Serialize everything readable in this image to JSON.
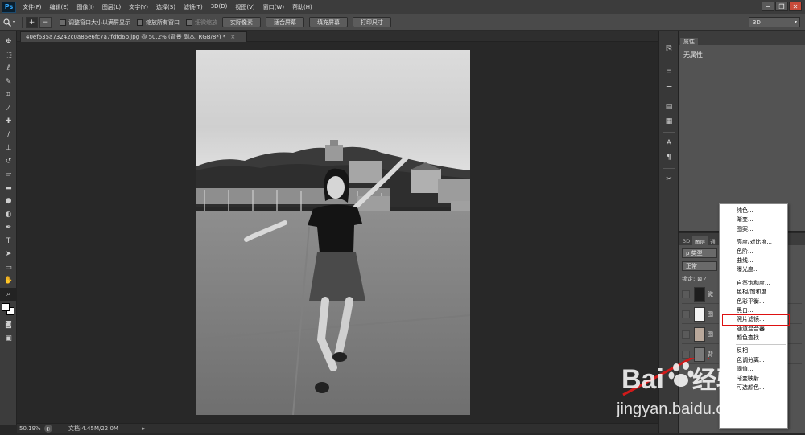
{
  "app": {
    "logo_text": "Ps"
  },
  "menu": [
    "文件(F)",
    "编辑(E)",
    "图像(I)",
    "图层(L)",
    "文字(Y)",
    "选择(S)",
    "滤镜(T)",
    "3D(D)",
    "视图(V)",
    "窗口(W)",
    "帮助(H)"
  ],
  "window_controls": {
    "minimize": "−",
    "restore": "❐",
    "close": "✕"
  },
  "options_bar": {
    "tool_icon": "zoom-icon",
    "zoom_in": "+",
    "zoom_out": "−",
    "checkboxes": [
      {
        "label": "调整窗口大小以满屏显示",
        "enabled": true
      },
      {
        "label": "缩放所有窗口",
        "enabled": true
      },
      {
        "label": "细微缩放",
        "enabled": false
      }
    ],
    "buttons": [
      "实际像素",
      "适合屏幕",
      "填充屏幕",
      "打印尺寸"
    ],
    "workspace": "3D"
  },
  "document": {
    "tab_title": "40ef635a73242c0a86e6fc7a7fdfd6b.jpg @ 50.2% (背景 副本, RGB/8*) *",
    "tab_close": "×"
  },
  "status": {
    "zoom": "50.19%",
    "doc_info": "文档:4.45M/22.0M",
    "arrow": "▸"
  },
  "properties_panel": {
    "tab": "属性",
    "body": "无属性"
  },
  "layers_panel": {
    "tabs": [
      "3D",
      "图层",
      "通"
    ],
    "filter": "ρ 类型",
    "blend_mode": "正常",
    "lock_label": "锁定:",
    "layers": [
      {
        "name": "微",
        "thumb": "#1e1e1e"
      },
      {
        "name": "图",
        "thumb": "#f4f4f4"
      },
      {
        "name": "图",
        "thumb": "#b9a89b"
      },
      {
        "name": "背",
        "thumb": "#7a7a7a"
      }
    ]
  },
  "context_menu": {
    "groups": [
      [
        "纯色...",
        "渐变...",
        "图案..."
      ],
      [
        "亮度/对比度...",
        "色阶...",
        "曲线...",
        "曝光度..."
      ],
      [
        "自然饱和度...",
        "色相/饱和度...",
        "色彩平衡...",
        "黑白...",
        "照片滤镜...",
        "通道混合器...",
        "颜色查找..."
      ],
      [
        "反相",
        "色调分离...",
        "阈值...",
        "渐变映射...",
        "可选颜色..."
      ]
    ],
    "highlighted": "照片滤镜..."
  },
  "watermark": {
    "brand": "Bai",
    "brand2": "经验",
    "url": "jingyan.baidu.com"
  },
  "colors": {
    "accent_red": "#d11a1a",
    "panel_bg": "#535353",
    "canvas_bg": "#282828"
  }
}
